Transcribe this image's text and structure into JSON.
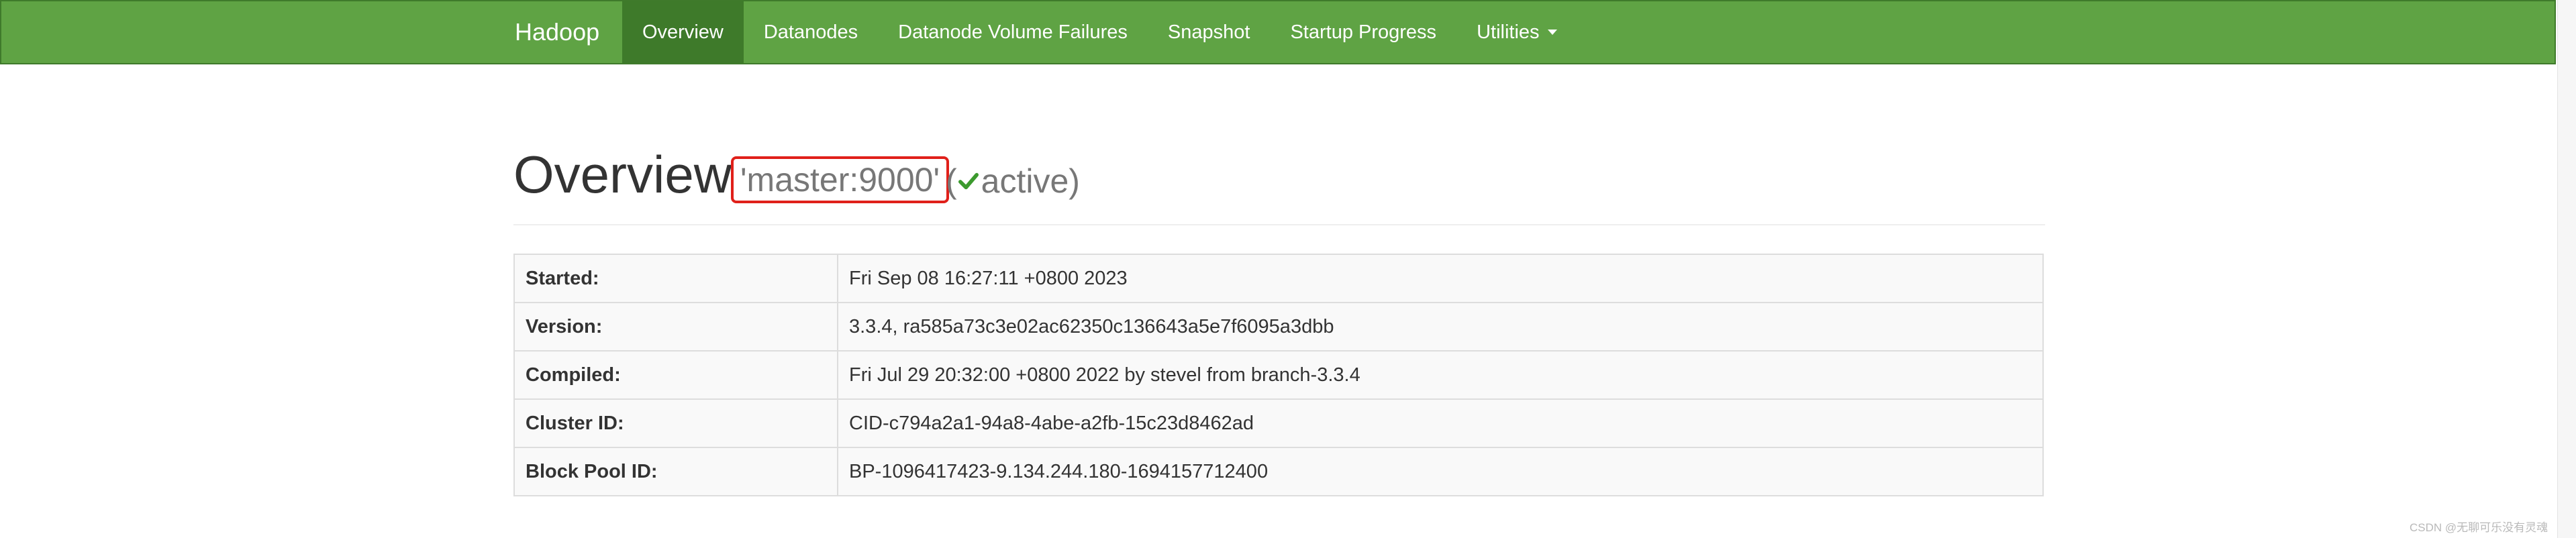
{
  "navbar": {
    "brand": "Hadoop",
    "items": [
      {
        "label": "Overview",
        "active": true
      },
      {
        "label": "Datanodes"
      },
      {
        "label": "Datanode Volume Failures"
      },
      {
        "label": "Snapshot"
      },
      {
        "label": "Startup Progress"
      },
      {
        "label": "Utilities"
      }
    ],
    "color": "#5fa344",
    "active_color": "#3e7a2a"
  },
  "header": {
    "title": "Overview",
    "host": "'master:9000'",
    "status_open": "(",
    "status_text": "active)",
    "status_icon": "check-icon",
    "highlight_color": "#e0201a"
  },
  "summary": {
    "rows": [
      {
        "label": "Started:",
        "value": "Fri Sep 08 16:27:11 +0800 2023"
      },
      {
        "label": "Version:",
        "value": "3.3.4, ra585a73c3e02ac62350c136643a5e7f6095a3dbb"
      },
      {
        "label": "Compiled:",
        "value": "Fri Jul 29 20:32:00 +0800 2022 by stevel from branch-3.3.4"
      },
      {
        "label": "Cluster ID:",
        "value": "CID-c794a2a1-94a8-4abe-a2fb-15c23d8462ad"
      },
      {
        "label": "Block Pool ID:",
        "value": "BP-1096417423-9.134.244.180-1694157712400"
      }
    ]
  },
  "watermark": "CSDN @无聊可乐没有灵魂"
}
